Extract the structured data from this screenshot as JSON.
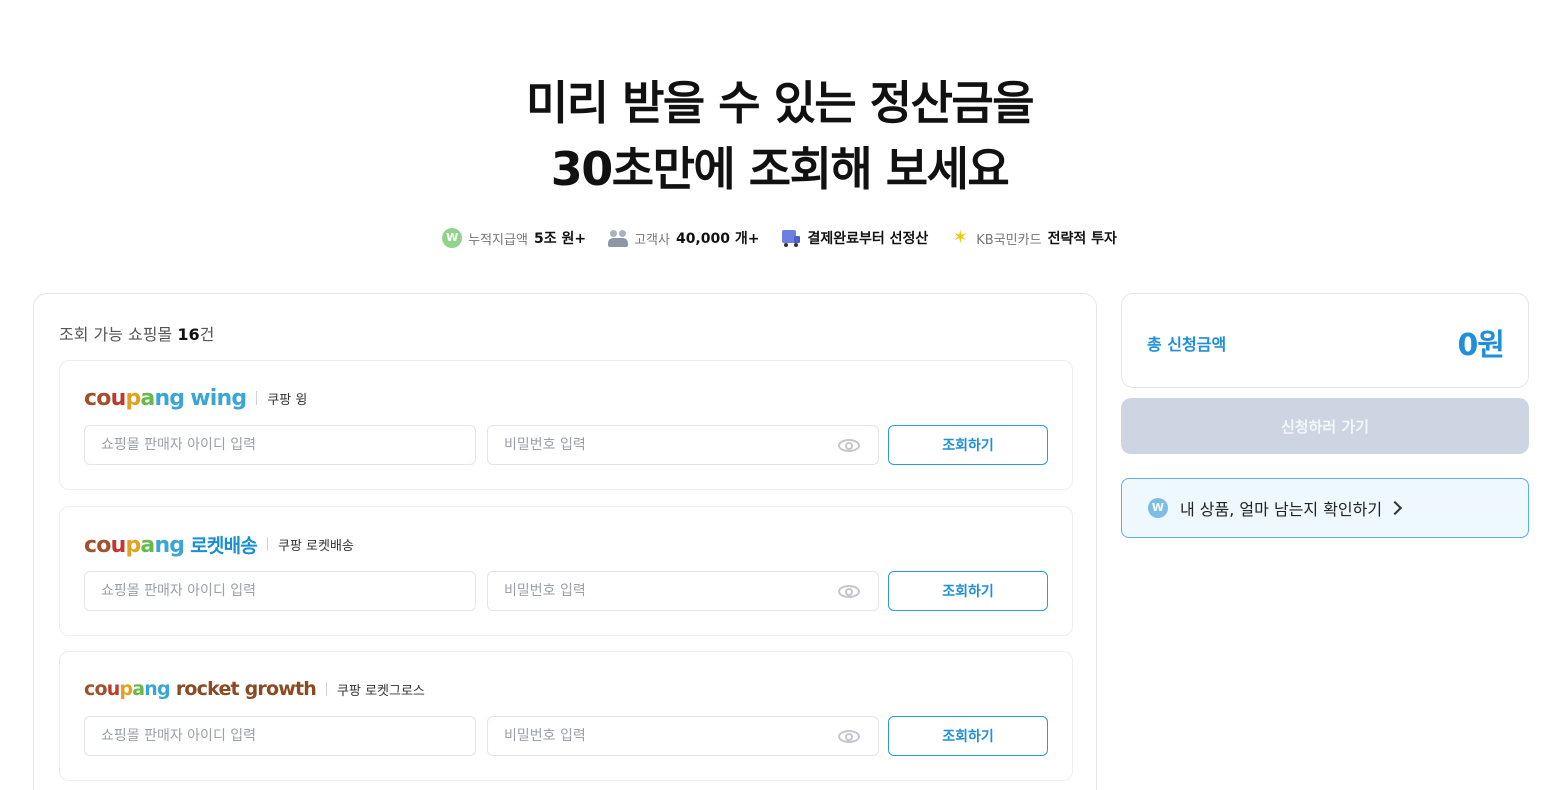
{
  "hero": {
    "line1": "미리 받을 수 있는 정산금을",
    "line2": "30초만에 조회해 보세요"
  },
  "stats": [
    {
      "icon": "won-coin-icon",
      "label": "누적지급액",
      "value": "5조 원+"
    },
    {
      "icon": "people-icon",
      "label": "고객사",
      "value": "40,000 개+"
    },
    {
      "icon": "truck-icon",
      "label": "",
      "value": "결제완료부터 선정산"
    },
    {
      "icon": "kb-star-icon",
      "label": "KB국민카드",
      "value": "전략적 투자"
    }
  ],
  "mall_list": {
    "count_prefix": "조회 가능 쇼핑몰",
    "count_value": "16",
    "count_suffix": "건",
    "malls": [
      {
        "logo_main": "coupang",
        "logo_sub": "wing",
        "name": "쿠팡 윙",
        "id_placeholder": "쇼핑몰 판매자 아이디 입력",
        "pw_placeholder": "비밀번호 입력",
        "check_label": "조회하기"
      },
      {
        "logo_main": "coupang",
        "logo_sub": "로켓배송",
        "name": "쿠팡 로켓배송",
        "id_placeholder": "쇼핑몰 판매자 아이디 입력",
        "pw_placeholder": "비밀번호 입력",
        "check_label": "조회하기"
      },
      {
        "logo_main": "coupang",
        "logo_sub": "rocket growth",
        "name": "쿠팡 로켓그로스",
        "id_placeholder": "쇼핑몰 판매자 아이디 입력",
        "pw_placeholder": "비밀번호 입력",
        "check_label": "조회하기"
      }
    ]
  },
  "summary": {
    "total_label": "총 신청금액",
    "total_amount": "0원",
    "apply_label": "신청하러 가기",
    "check_link_label": "내 상품, 얼마 남는지 확인하기"
  },
  "colors": {
    "accent": "#1e8fd8",
    "apply_disabled": "#ccd5e1",
    "link_bg": "#eef8fe"
  }
}
